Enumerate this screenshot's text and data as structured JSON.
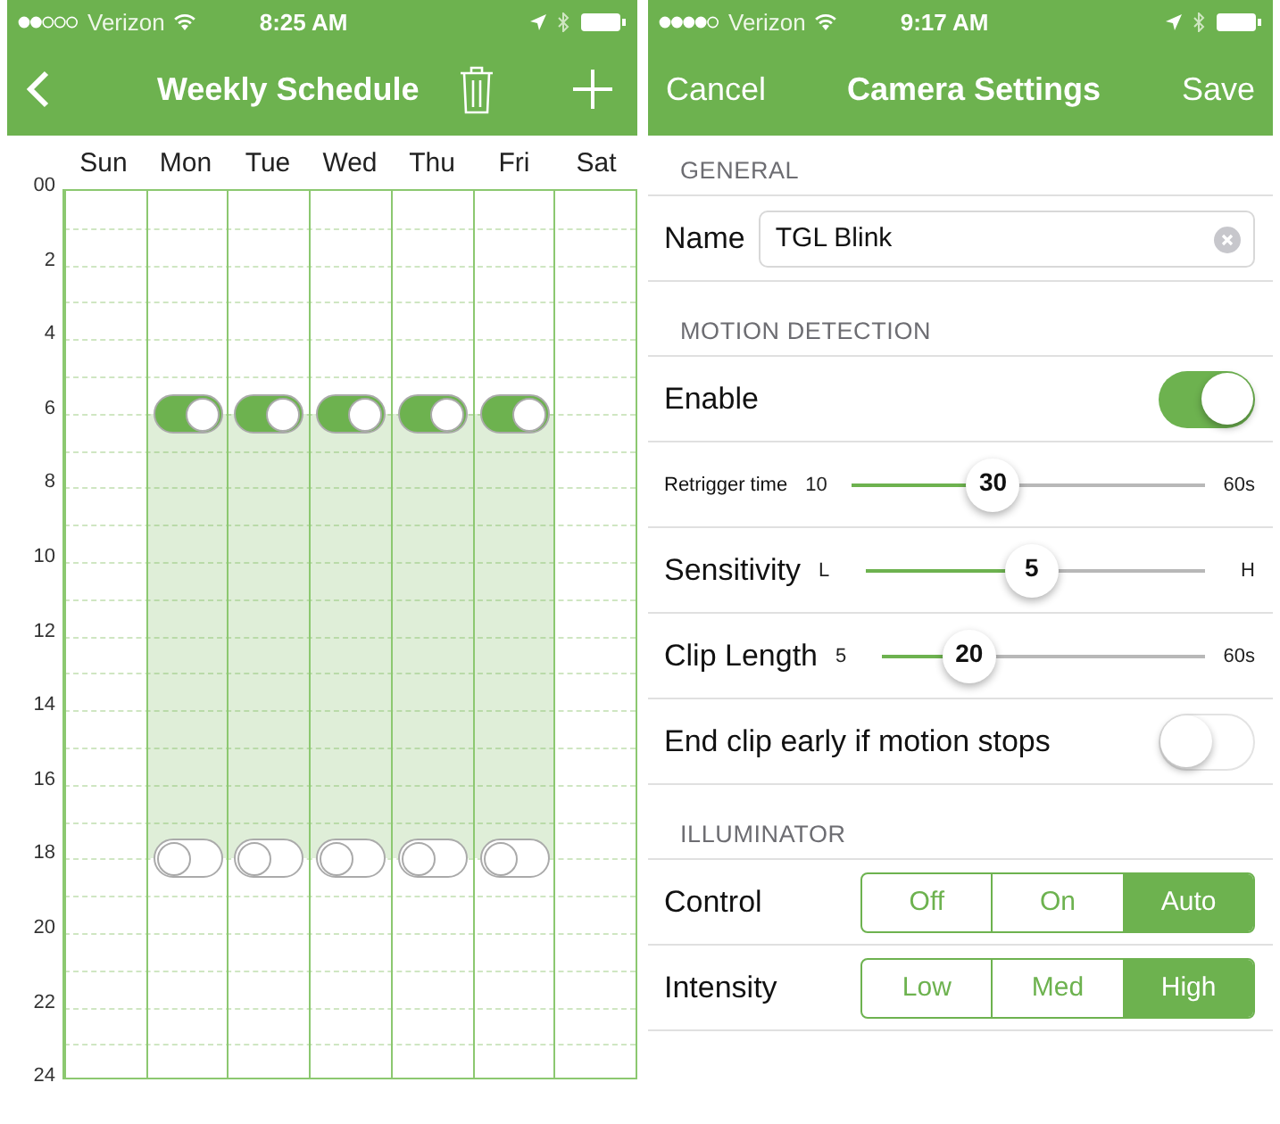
{
  "schedule_screen": {
    "status_bar": {
      "carrier": "Verizon",
      "time": "8:25 AM"
    },
    "nav": {
      "title": "Weekly Schedule"
    },
    "days": [
      "Sun",
      "Mon",
      "Tue",
      "Wed",
      "Thu",
      "Fri",
      "Sat"
    ],
    "hours": [
      {
        "label": "00"
      },
      {
        "label": "2"
      },
      {
        "label": "4"
      },
      {
        "label": "6",
        "switches": [
          {
            "kind": "empty"
          },
          {
            "kind": "switch",
            "on": true
          },
          {
            "kind": "switch",
            "on": true
          },
          {
            "kind": "switch",
            "on": true
          },
          {
            "kind": "switch",
            "on": true
          },
          {
            "kind": "switch",
            "on": true
          },
          {
            "kind": "empty"
          }
        ]
      },
      {
        "label": "8"
      },
      {
        "label": "10"
      },
      {
        "label": "12"
      },
      {
        "label": "14"
      },
      {
        "label": "16"
      },
      {
        "label": "18",
        "switches": [
          {
            "kind": "empty"
          },
          {
            "kind": "switch",
            "on": false
          },
          {
            "kind": "switch",
            "on": false
          },
          {
            "kind": "switch",
            "on": false
          },
          {
            "kind": "switch",
            "on": false
          },
          {
            "kind": "switch",
            "on": false
          },
          {
            "kind": "empty"
          }
        ]
      },
      {
        "label": "20"
      },
      {
        "label": "22"
      },
      {
        "label": "24"
      }
    ]
  },
  "settings_screen": {
    "status_bar": {
      "carrier": "Verizon",
      "time": "9:17 AM"
    },
    "nav": {
      "cancel": "Cancel",
      "title": "Camera Settings",
      "save": "Save"
    },
    "sections": [
      {
        "header": "GENERAL",
        "rows": [
          {
            "kind": "text_field",
            "label": "Name",
            "value": "TGL Blink"
          }
        ]
      },
      {
        "header": "MOTION DETECTION",
        "rows": [
          {
            "kind": "toggle",
            "label": "Enable",
            "on": true
          },
          {
            "kind": "slider",
            "label": "Retrigger time",
            "compact": true,
            "min": "10",
            "max": "60s",
            "reading": "30",
            "level": 0.4
          },
          {
            "kind": "slider",
            "label": "Sensitivity",
            "compact": false,
            "min": "L",
            "max": "H",
            "reading": "5",
            "level": 0.49
          },
          {
            "kind": "slider",
            "label": "Clip Length",
            "compact": false,
            "min": "5",
            "max": "60s",
            "reading": "20",
            "level": 0.27
          },
          {
            "kind": "toggle",
            "label": "End clip early if motion stops",
            "on": false
          }
        ]
      },
      {
        "header": "ILLUMINATOR",
        "rows": [
          {
            "kind": "segmented",
            "label": "Control",
            "options": [
              {
                "label": "Off",
                "selected": false
              },
              {
                "label": "On",
                "selected": false
              },
              {
                "label": "Auto",
                "selected": true
              }
            ]
          },
          {
            "kind": "segmented",
            "label": "Intensity",
            "options": [
              {
                "label": "Low",
                "selected": false
              },
              {
                "label": "Med",
                "selected": false
              },
              {
                "label": "High",
                "selected": true
              }
            ]
          }
        ]
      }
    ]
  }
}
